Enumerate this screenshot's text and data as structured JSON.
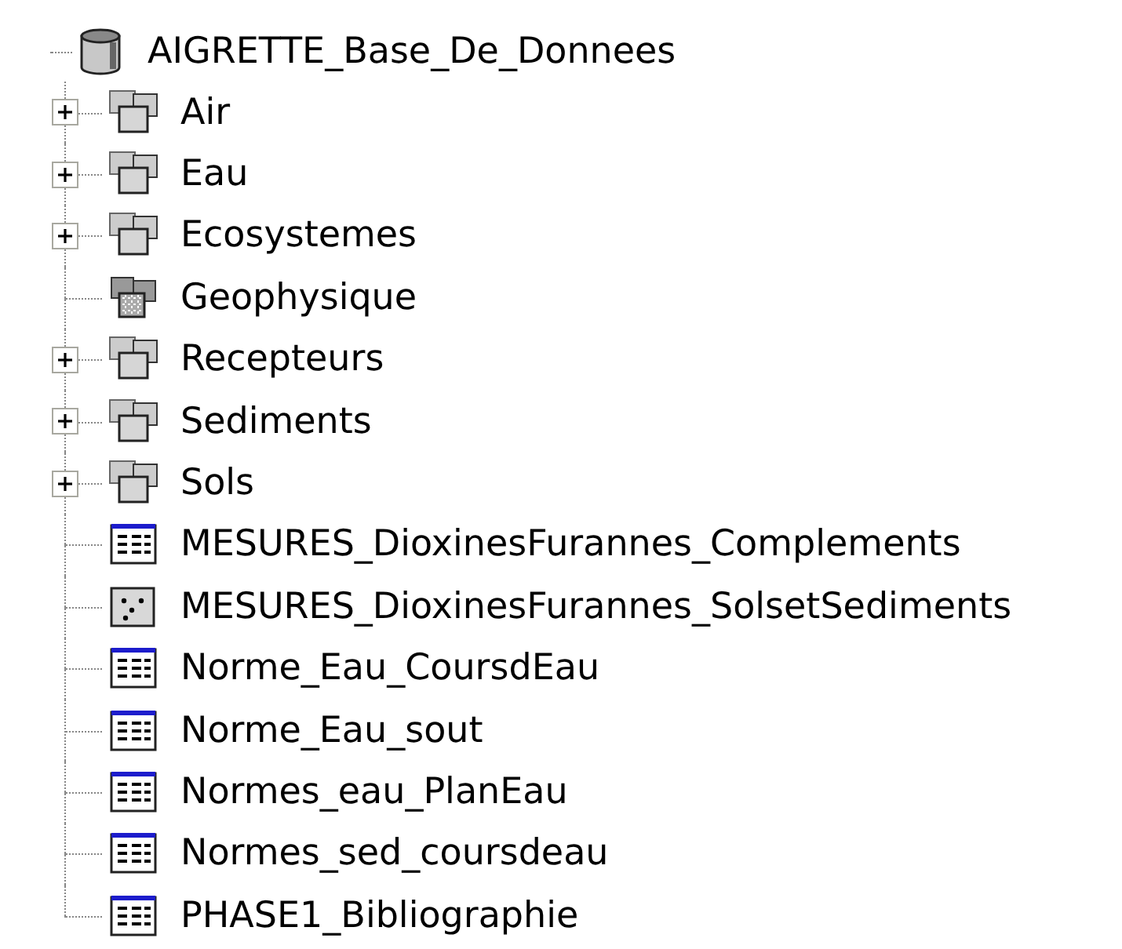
{
  "tree": {
    "root": {
      "label": "AIGRETTE_Base_De_Donnees",
      "kind": "database"
    },
    "children": [
      {
        "label": "Air",
        "kind": "dataset",
        "expanded": false
      },
      {
        "label": "Eau",
        "kind": "dataset",
        "expanded": false
      },
      {
        "label": "Ecosystemes",
        "kind": "dataset",
        "expanded": false
      },
      {
        "label": "Geophysique",
        "kind": "raster"
      },
      {
        "label": "Recepteurs",
        "kind": "dataset",
        "expanded": false
      },
      {
        "label": "Sediments",
        "kind": "dataset",
        "expanded": false
      },
      {
        "label": "Sols",
        "kind": "dataset",
        "expanded": false
      },
      {
        "label": "MESURES_DioxinesFurannes_Complements",
        "kind": "table"
      },
      {
        "label": "MESURES_DioxinesFurannes_SolsetSediments",
        "kind": "points"
      },
      {
        "label": "Norme_Eau_CoursdEau",
        "kind": "table"
      },
      {
        "label": "Norme_Eau_sout",
        "kind": "table"
      },
      {
        "label": "Normes_eau_PlanEau",
        "kind": "table"
      },
      {
        "label": "Normes_sed_coursdeau",
        "kind": "table"
      },
      {
        "label": "PHASE1_Bibliographie",
        "kind": "table"
      }
    ]
  }
}
